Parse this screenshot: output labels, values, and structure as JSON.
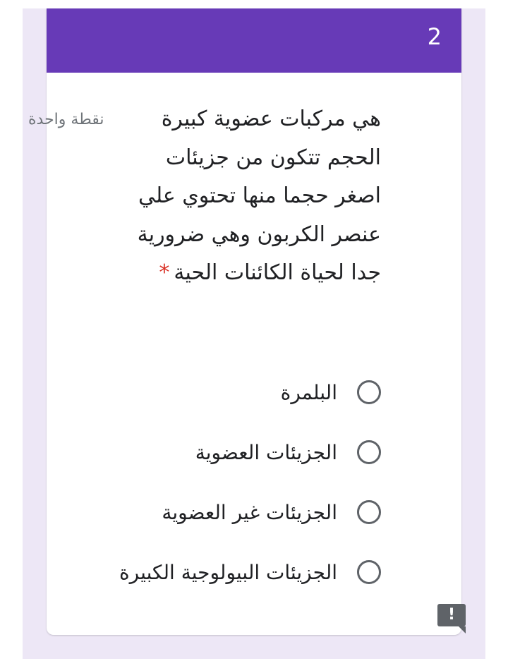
{
  "question": {
    "number": "2",
    "title": "هي مركبات عضوية كبيرة الحجم تتكون من جزيئات اصغر حجما منها تحتوي علي عنصر الكربون وهي ضرورية جدا لحياة الكائنات الحية",
    "required_marker": "*",
    "points": "نقطة واحدة"
  },
  "options": [
    {
      "label": "البلمرة"
    },
    {
      "label": "الجزيئات العضوية"
    },
    {
      "label": "الجزيئات غير العضوية"
    },
    {
      "label": "الجزيئات البيولوجية الكبيرة"
    }
  ],
  "report_button": {
    "glyph": "!"
  },
  "colors": {
    "header": "#673ab7",
    "background": "#ede7f6",
    "required": "#d93025"
  }
}
